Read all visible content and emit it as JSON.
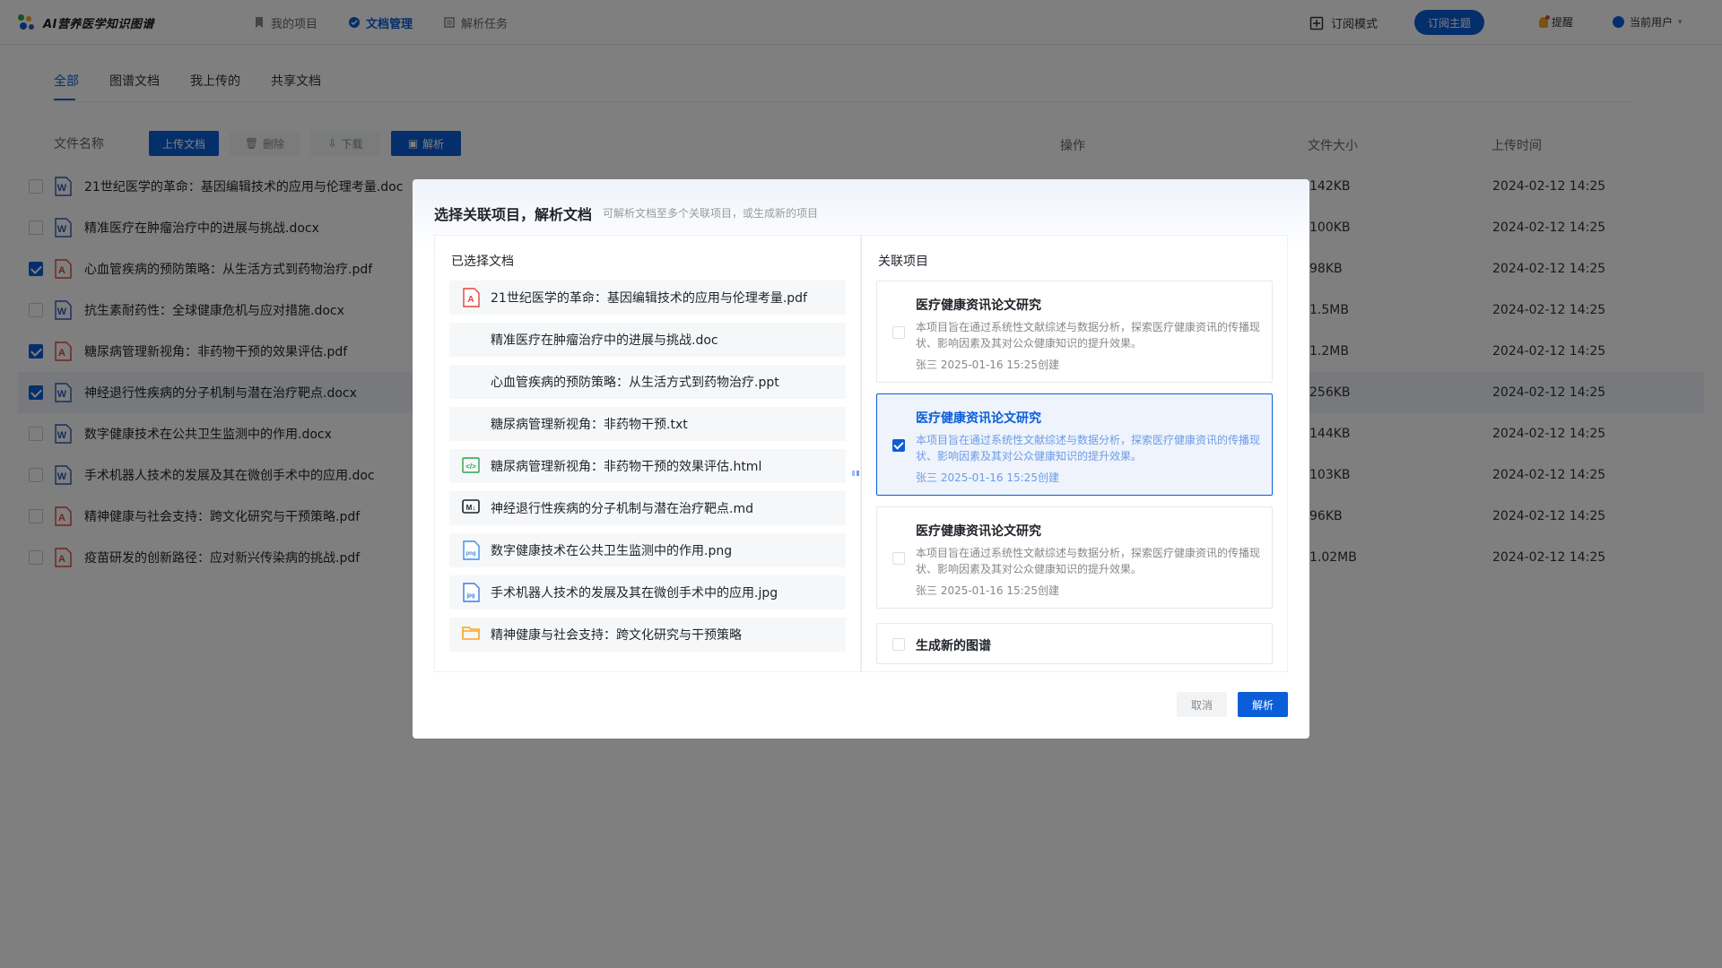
{
  "app": {
    "title": "AI营养医学知识图谱"
  },
  "nav": [
    {
      "label": "我的项目",
      "icon": "bookmark-icon",
      "active": false
    },
    {
      "label": "文档管理",
      "icon": "document-manage-icon",
      "active": true
    },
    {
      "label": "解析任务",
      "icon": "task-list-icon",
      "active": false
    }
  ],
  "header": {
    "subscribe_mode": "订阅模式",
    "subscribe_topic": "订阅主题",
    "remind": "提醒",
    "current_user": "当前用户"
  },
  "tabs": [
    "全部",
    "图谱文档",
    "我上传的",
    "共享文档"
  ],
  "toolbar": {
    "filename_header": "文件名称",
    "upload": "上传文档",
    "delete": "删除",
    "download": "下载",
    "parse": "解析"
  },
  "columns": {
    "operation": "操作",
    "size": "文件大小",
    "time": "上传时间"
  },
  "files": [
    {
      "name": "21世纪医学的革命：基因编辑技术的应用与伦理考量.doc",
      "type": "word",
      "checked": false,
      "size": "142KB",
      "time": "2024-02-12  14:25"
    },
    {
      "name": "精准医疗在肿瘤治疗中的进展与挑战.docx",
      "type": "word",
      "checked": false,
      "size": "100KB",
      "time": "2024-02-12  14:25"
    },
    {
      "name": "心血管疾病的预防策略：从生活方式到药物治疗.pdf",
      "type": "pdf",
      "checked": true,
      "size": "98KB",
      "time": "2024-02-12  14:25"
    },
    {
      "name": "抗生素耐药性：全球健康危机与应对措施.docx",
      "type": "word",
      "checked": false,
      "size": "1.5MB",
      "time": "2024-02-12  14:25"
    },
    {
      "name": "糖尿病管理新视角：非药物干预的效果评估.pdf",
      "type": "pdf",
      "checked": true,
      "size": "1.2MB",
      "time": "2024-02-12  14:25"
    },
    {
      "name": "神经退行性疾病的分子机制与潜在治疗靶点.docx",
      "type": "word",
      "checked": true,
      "size": "256KB",
      "time": "2024-02-12  14:25"
    },
    {
      "name": "数字健康技术在公共卫生监测中的作用.docx",
      "type": "word",
      "checked": false,
      "size": "144KB",
      "time": "2024-02-12  14:25"
    },
    {
      "name": "手术机器人技术的发展及其在微创手术中的应用.doc",
      "type": "word",
      "checked": false,
      "size": "103KB",
      "time": "2024-02-12  14:25"
    },
    {
      "name": "精神健康与社会支持：跨文化研究与干预策略.pdf",
      "type": "pdf",
      "checked": false,
      "size": "96KB",
      "time": "2024-02-12  14:25"
    },
    {
      "name": "疫苗研发的创新路径：应对新兴传染病的挑战.pdf",
      "type": "pdf",
      "checked": false,
      "size": "1.02MB",
      "time": "2024-02-12  14:25"
    }
  ],
  "modal": {
    "title": "选择关联项目，解析文档",
    "subtitle": "可解析文档至多个关联项目，或生成新的项目",
    "selected_title": "已选择文档",
    "related_title": "关联项目",
    "selected_docs": [
      {
        "name": "21世纪医学的革命：基因编辑技术的应用与伦理考量.pdf",
        "icon": "pdf-icon"
      },
      {
        "name": "精准医疗在肿瘤治疗中的进展与挑战.doc",
        "icon": "word-icon"
      },
      {
        "name": "心血管疾病的预防策略：从生活方式到药物治疗.ppt",
        "icon": "ppt-icon"
      },
      {
        "name": "糖尿病管理新视角：非药物干预.txt",
        "icon": "txt-icon"
      },
      {
        "name": "糖尿病管理新视角：非药物干预的效果评估.html",
        "icon": "html-icon"
      },
      {
        "name": "神经退行性疾病的分子机制与潜在治疗靶点.md",
        "icon": "markdown-icon"
      },
      {
        "name": "数字健康技术在公共卫生监测中的作用.png",
        "icon": "png-icon"
      },
      {
        "name": "手术机器人技术的发展及其在微创手术中的应用.jpg",
        "icon": "jpg-icon"
      },
      {
        "name": "精神健康与社会支持：跨文化研究与干预策略",
        "icon": "folder-icon"
      }
    ],
    "projects": [
      {
        "title": "医疗健康资讯论文研究",
        "desc": "本项目旨在通过系统性文献综述与数据分析，探索医疗健康资讯的传播现状、影响因素及其对公众健康知识的提升效果。",
        "meta": "张三   2025-01-16  15:25创建",
        "checked": false
      },
      {
        "title": "医疗健康资讯论文研究",
        "desc": "本项目旨在通过系统性文献综述与数据分析，探索医疗健康资讯的传播现状、影响因素及其对公众健康知识的提升效果。",
        "meta": "张三   2025-01-16  15:25创建",
        "checked": true
      },
      {
        "title": "医疗健康资讯论文研究",
        "desc": "本项目旨在通过系统性文献综述与数据分析，探索医疗健康资讯的传播现状、影响因素及其对公众健康知识的提升效果。",
        "meta": "张三   2025-01-16  15:25创建",
        "checked": false
      }
    ],
    "new_graph": "生成新的图谱",
    "cancel": "取消",
    "confirm": "解析"
  },
  "colors": {
    "primary": "#0b5ed7",
    "pdf": "#e0463a",
    "word": "#2f5bb7",
    "html": "#2da44e",
    "folder": "#f5a623"
  }
}
